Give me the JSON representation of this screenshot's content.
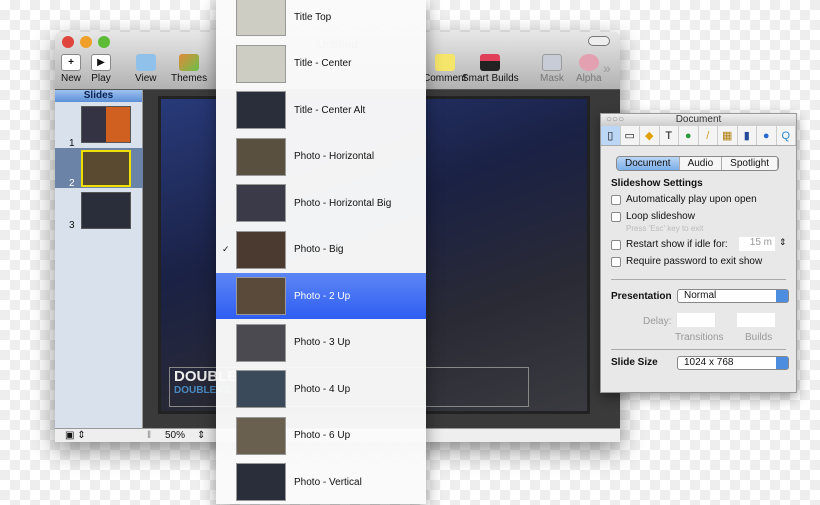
{
  "window": {
    "title": "Untitled",
    "toolbar": [
      {
        "label": "New",
        "icon": "plus-icon"
      },
      {
        "label": "Play",
        "icon": "play-icon"
      },
      {
        "label": "View",
        "icon": "view-icon"
      },
      {
        "label": "Themes",
        "icon": "themes-icon"
      },
      {
        "label": "Comment",
        "icon": "comment-icon"
      },
      {
        "label": "Smart Builds",
        "icon": "smart-builds-icon"
      },
      {
        "label": "Mask",
        "icon": "mask-icon"
      },
      {
        "label": "Alpha",
        "icon": "alpha-icon"
      }
    ]
  },
  "sidebar": {
    "header": "Slides",
    "slides": [
      {
        "num": "1"
      },
      {
        "num": "2",
        "selected": true
      },
      {
        "num": "3"
      }
    ]
  },
  "slide": {
    "title": "DOUBLE",
    "subtitle": "DOUBLE-CL"
  },
  "bottom": {
    "zoom": "50%"
  },
  "menu": {
    "items": [
      {
        "label": "Title Top"
      },
      {
        "label": "Title - Center"
      },
      {
        "label": "Title - Center Alt"
      },
      {
        "label": "Photo - Horizontal"
      },
      {
        "label": "Photo - Horizontal Big"
      },
      {
        "label": "Photo - Big",
        "checked": true
      },
      {
        "label": "Photo - 2 Up",
        "highlighted": true
      },
      {
        "label": "Photo - 3 Up"
      },
      {
        "label": "Photo - 4 Up"
      },
      {
        "label": "Photo - 6 Up"
      },
      {
        "label": "Photo - Vertical"
      }
    ],
    "check": "✓"
  },
  "inspector": {
    "title": "Document",
    "tabs": [
      "Document",
      "Audio",
      "Spotlight"
    ],
    "section": "Slideshow Settings",
    "auto_play": "Automatically play upon open",
    "loop": "Loop slideshow",
    "loop_hint": "Press 'Esc' key to exit",
    "restart": "Restart show if idle for:",
    "idle_value": "15 m",
    "password": "Require password to exit show",
    "presentation_label": "Presentation",
    "presentation_value": "Normal",
    "delay_label": "Delay:",
    "transitions": "Transitions",
    "builds": "Builds",
    "slide_size_label": "Slide Size",
    "slide_size_value": "1024 x 768"
  }
}
